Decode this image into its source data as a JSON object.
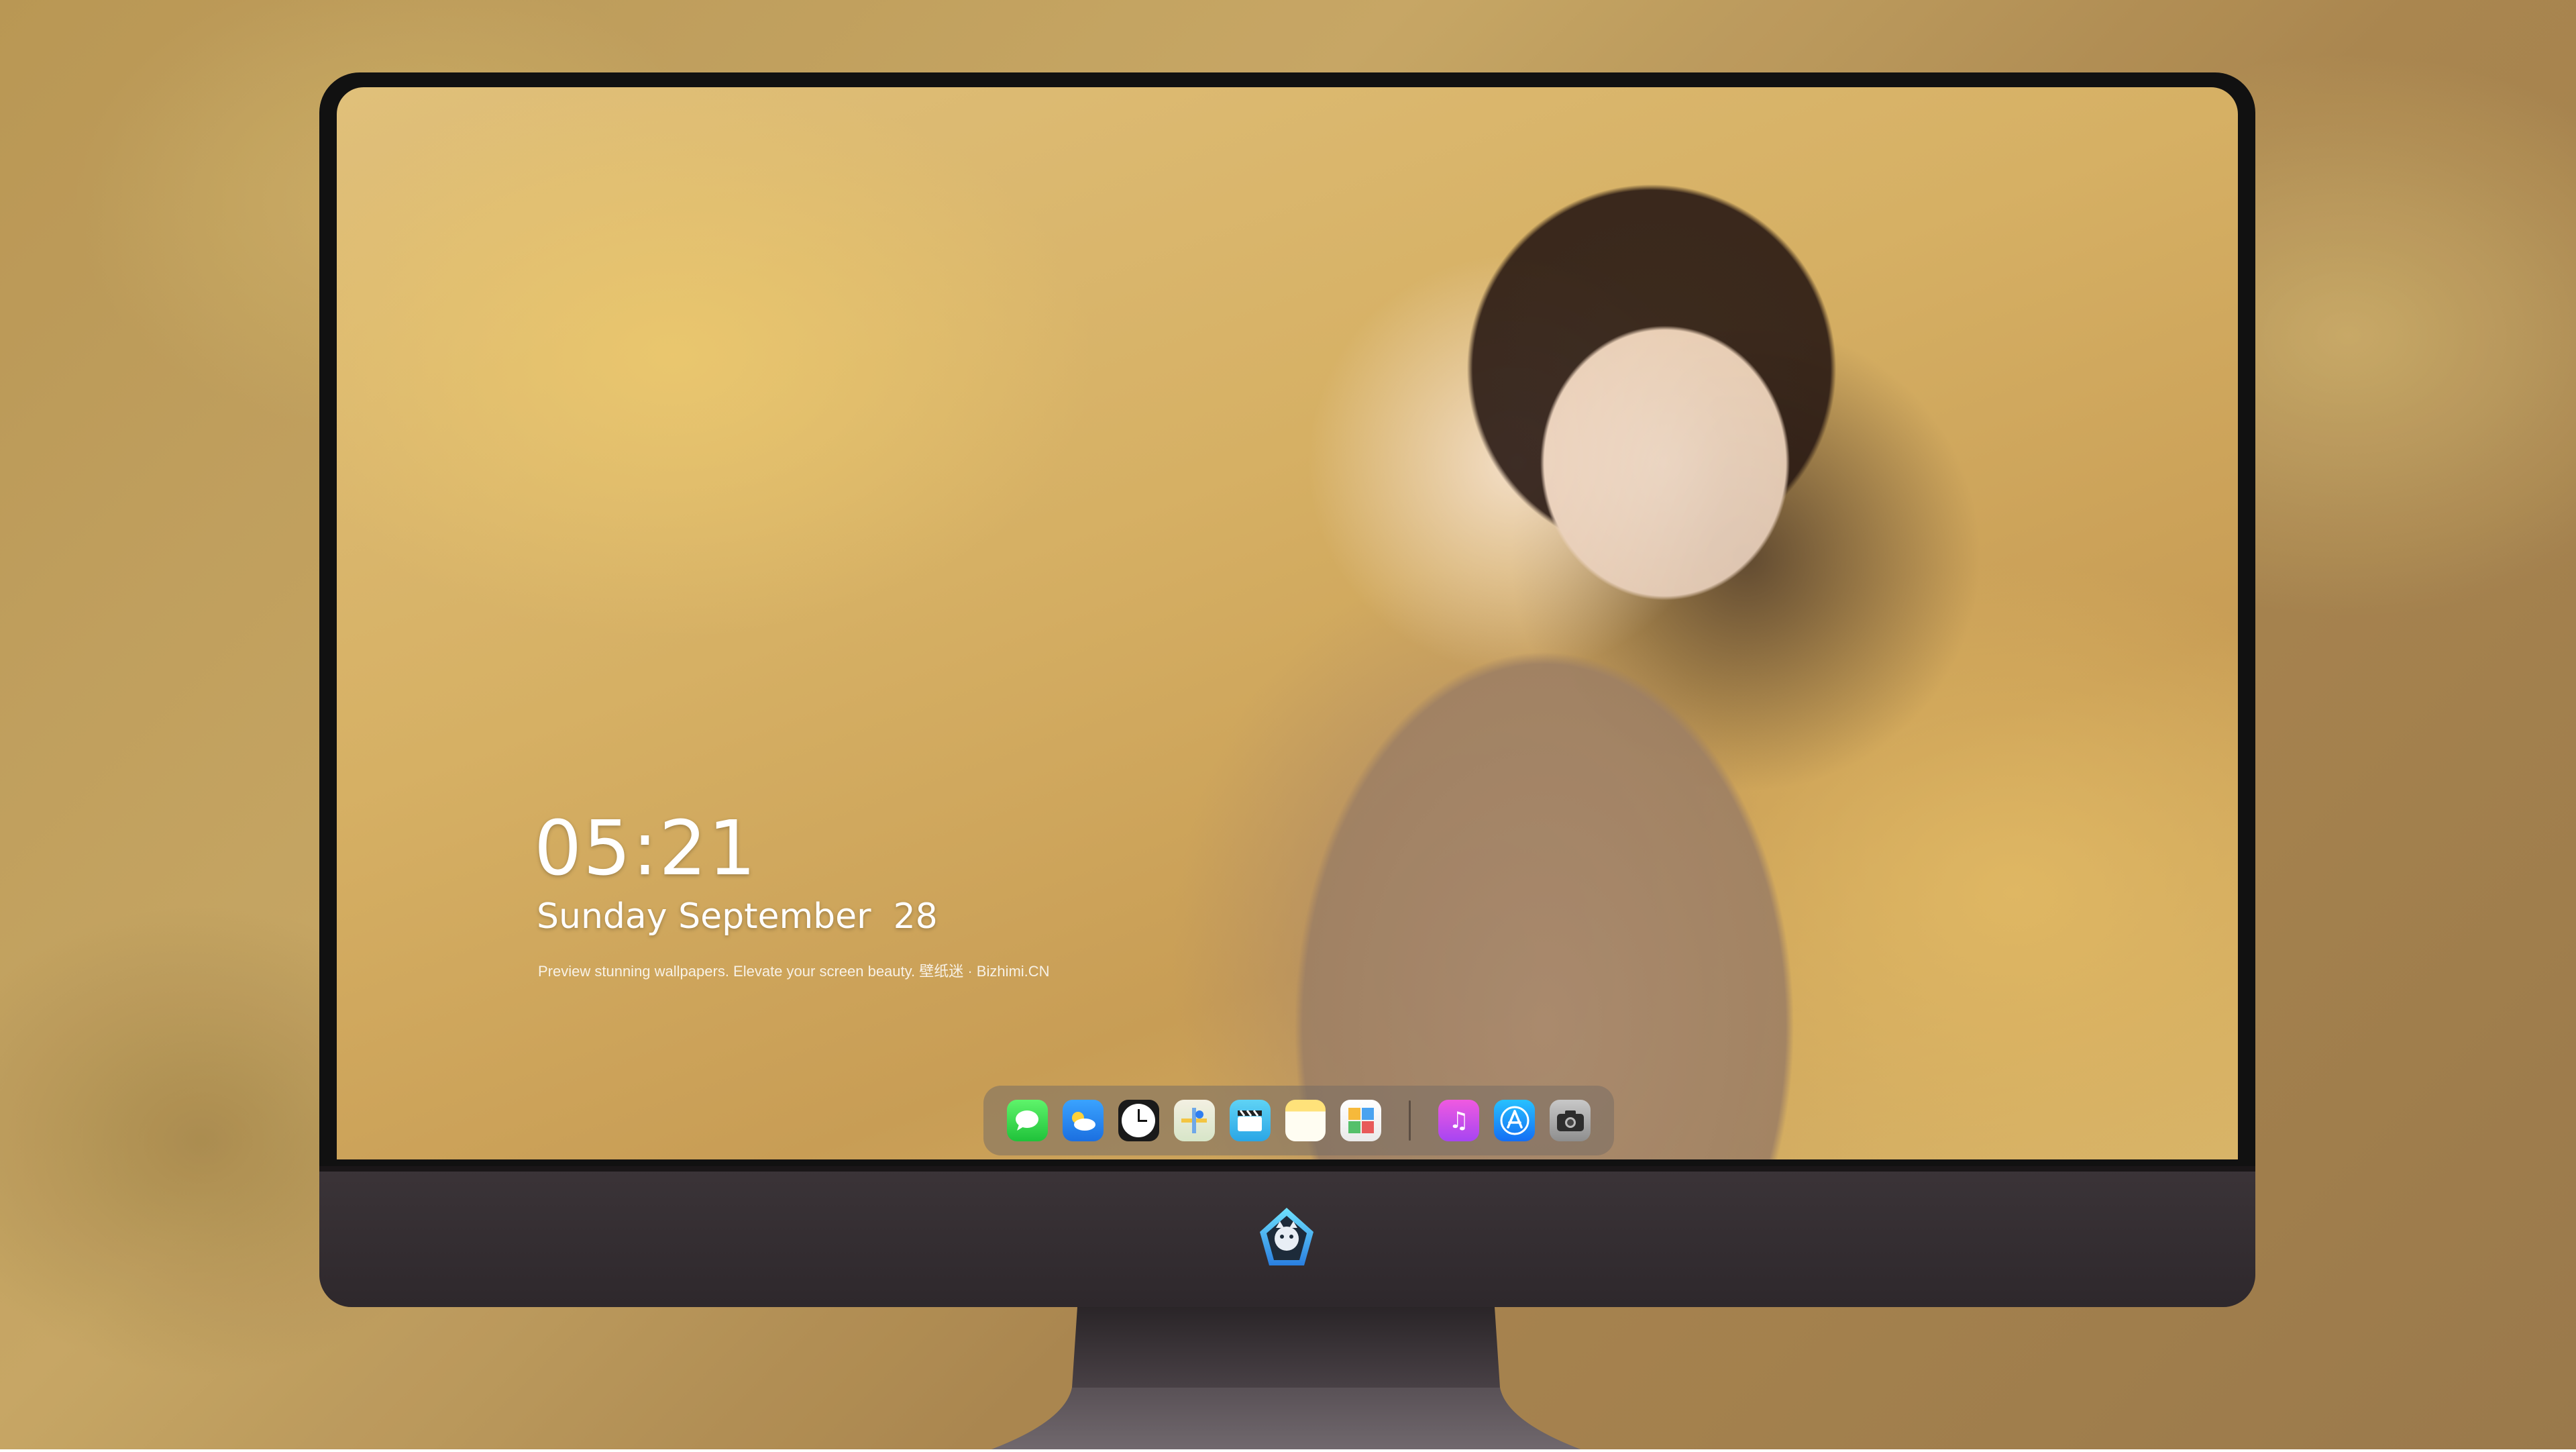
{
  "lockscreen": {
    "time": "05:21",
    "date": "Sunday September  28",
    "tagline": "Preview stunning wallpapers. Elevate your screen beauty. 壁纸迷 · Bizhimi.CN"
  },
  "dock": {
    "apps": [
      {
        "name": "Messages",
        "icon": "messages-icon"
      },
      {
        "name": "Weather",
        "icon": "weather-icon"
      },
      {
        "name": "Clock",
        "icon": "clock-icon"
      },
      {
        "name": "Maps",
        "icon": "maps-icon"
      },
      {
        "name": "Clips",
        "icon": "clapperboard-icon"
      },
      {
        "name": "Notes",
        "icon": "notes-icon"
      },
      {
        "name": "Photos",
        "icon": "photos-icon"
      },
      {
        "name": "Music",
        "icon": "music-note-icon"
      },
      {
        "name": "App Store",
        "icon": "app-store-icon"
      },
      {
        "name": "Camera",
        "icon": "camera-icon"
      }
    ]
  },
  "colors": {
    "bezel": "#111111",
    "chin": "#3b3438",
    "dock_bg": "rgba(120,110,100,0.55)",
    "text": "#ffffff"
  }
}
